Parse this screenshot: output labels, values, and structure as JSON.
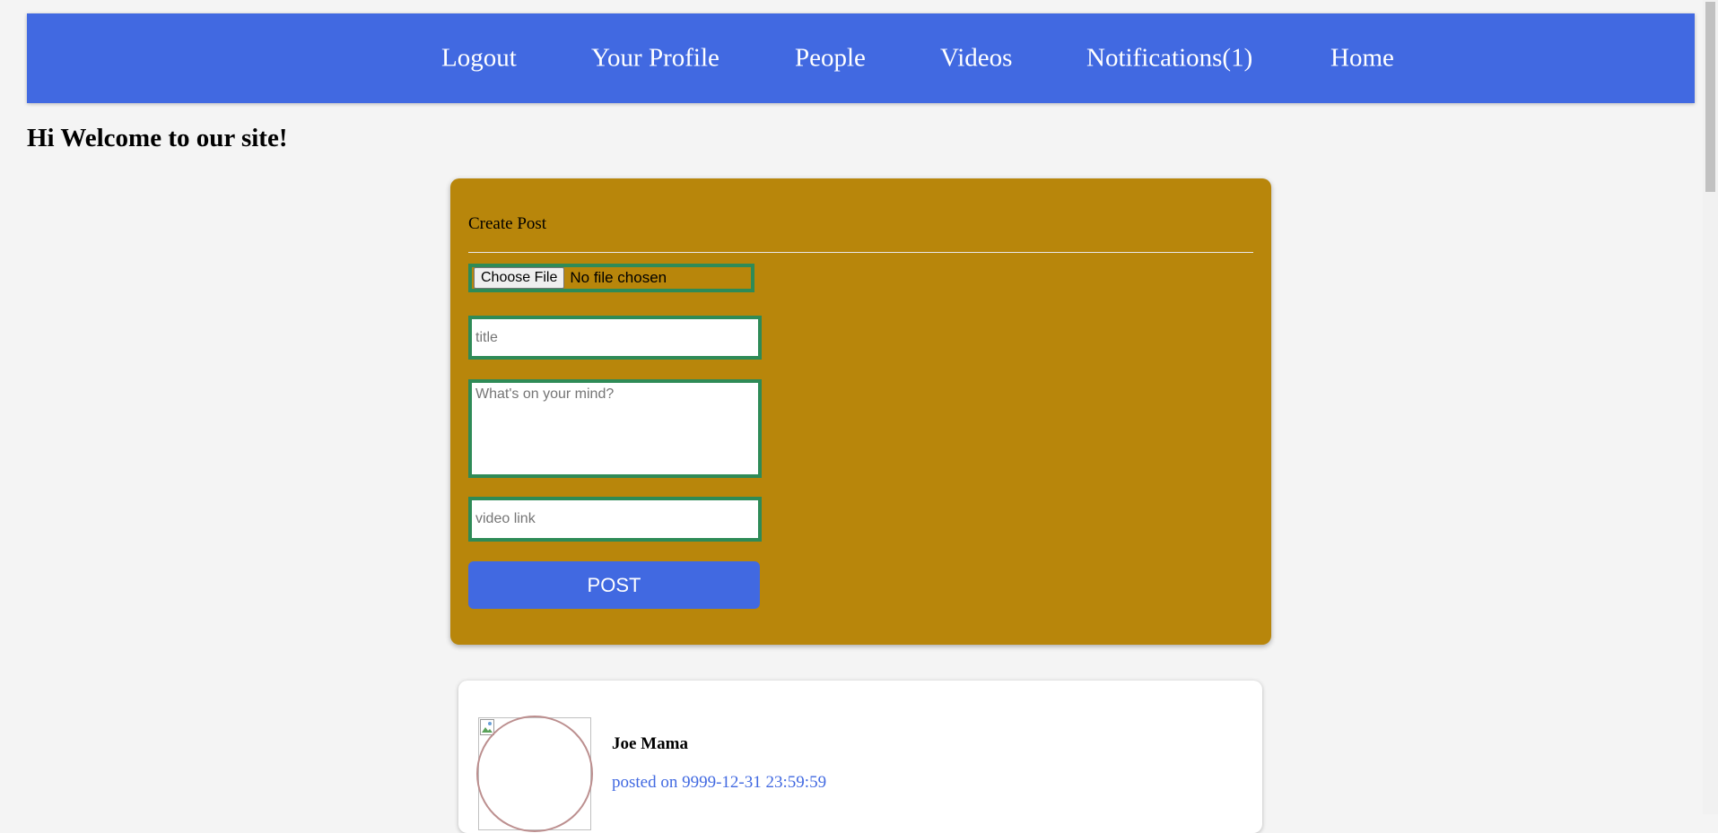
{
  "nav": {
    "items": [
      {
        "label": "Logout"
      },
      {
        "label": "Your Profile"
      },
      {
        "label": "People"
      },
      {
        "label": "Videos"
      },
      {
        "label": "Notifications(1)"
      },
      {
        "label": "Home"
      }
    ]
  },
  "welcome": "Hi Welcome to our site!",
  "create_post": {
    "heading": "Create Post",
    "file_button": "Choose File",
    "file_status": "No file chosen",
    "title_placeholder": "title",
    "body_placeholder": "What's on your mind?",
    "video_placeholder": "video link",
    "submit_label": "POST"
  },
  "feed": [
    {
      "author": "Joe Mama",
      "posted": "posted on 9999-12-31 23:59:59"
    }
  ],
  "colors": {
    "navbar": "#4169e1",
    "card": "#b8860b",
    "field_border": "#2e8b57",
    "button": "#4169e1",
    "link": "#4169e1"
  }
}
